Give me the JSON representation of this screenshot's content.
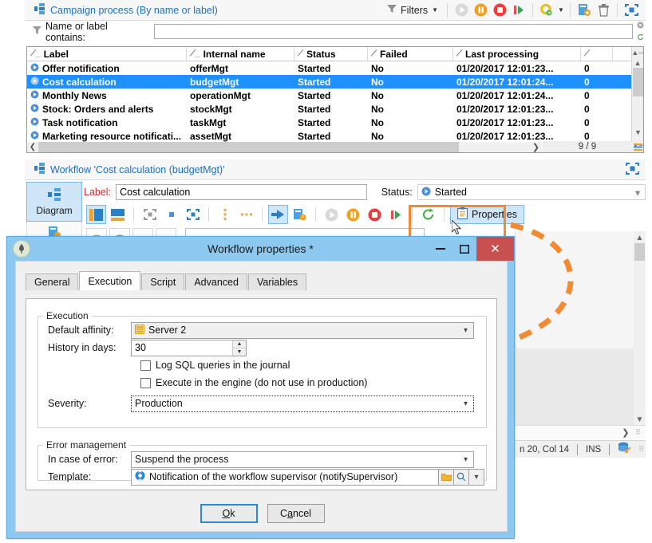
{
  "top_toolbar": {
    "title": "Campaign process (By name or label)",
    "filters_label": "Filters",
    "icons": [
      "funnel-icon",
      "play-disabled-icon",
      "pause-icon",
      "stop-icon",
      "start-icon",
      "settings-gear-icon",
      "duplicate-icon",
      "delete-icon",
      "fullscreen-icon"
    ]
  },
  "filter_row": {
    "label": "Name or label contains:",
    "value": "",
    "placeholder": ""
  },
  "grid": {
    "columns": [
      "Label",
      "Internal name",
      "Status",
      "Failed",
      "Last processing"
    ],
    "rows": [
      {
        "label": "Offer notification",
        "internal": "offerMgt",
        "status": "Started",
        "failed": "No",
        "last": "01/20/2017 12:01:23...",
        "extra": "0",
        "selected": false
      },
      {
        "label": "Cost calculation",
        "internal": "budgetMgt",
        "status": "Started",
        "failed": "No",
        "last": "01/20/2017 12:01:24...",
        "extra": "0",
        "selected": true
      },
      {
        "label": "Monthly News",
        "internal": "operationMgt",
        "status": "Started",
        "failed": "No",
        "last": "01/20/2017 12:01:24...",
        "extra": "0",
        "selected": false
      },
      {
        "label": "Stock: Orders and alerts",
        "internal": "stockMgt",
        "status": "Started",
        "failed": "No",
        "last": "01/20/2017 12:01:23...",
        "extra": "0",
        "selected": false
      },
      {
        "label": "Task notification",
        "internal": "taskMgt",
        "status": "Started",
        "failed": "No",
        "last": "01/20/2017 12:01:23...",
        "extra": "0",
        "selected": false
      },
      {
        "label": "Marketing resource notificati...",
        "internal": "assetMgt",
        "status": "Started",
        "failed": "No",
        "last": "01/20/2017 12:01:23...",
        "extra": "0",
        "selected": false
      }
    ],
    "count": "9 / 9"
  },
  "workflow": {
    "panel_title": "Workflow 'Cost calculation (budgetMgt)'",
    "left_tab": "Diagram",
    "label_caption": "Label:",
    "label_value": "Cost calculation",
    "status_caption": "Status:",
    "status_value": "Started",
    "properties_button": "Properties"
  },
  "status_strip": {
    "position": "n 20, Col 14",
    "mode": "INS",
    "db_icon": "database-key-icon"
  },
  "dialog": {
    "title": "Workflow properties *",
    "tabs": [
      {
        "label": "General",
        "active": false
      },
      {
        "label": "Execution",
        "active": true
      },
      {
        "label": "Script",
        "active": false
      },
      {
        "label": "Advanced",
        "active": false
      },
      {
        "label": "Variables",
        "active": false
      }
    ],
    "execution_group": {
      "legend": "Execution",
      "default_affinity_label": "Default affinity:",
      "default_affinity_value": "Server 2",
      "history_label": "History in days:",
      "history_value": "30",
      "log_sql_label": "Log SQL queries in the journal",
      "log_sql_checked": false,
      "execute_engine_label": "Execute in the engine (do not use in production)",
      "execute_engine_checked": false,
      "severity_label": "Severity:",
      "severity_value": "Production"
    },
    "error_group": {
      "legend": "Error management",
      "in_case_label": "In case of error:",
      "in_case_value": "Suspend the process",
      "template_label": "Template:",
      "template_value": "Notification of the workflow supervisor (notifySupervisor)"
    },
    "buttons": {
      "ok": "Ok",
      "cancel": "Cancel"
    },
    "window_controls": {
      "minimize": "–",
      "maximize": "□",
      "close": "✕"
    }
  },
  "colors": {
    "accent_blue": "#1e90ff",
    "annotation_orange": "#F08A33",
    "dialog_frame": "#8CC8F0",
    "close_red": "#C75050",
    "link_blue": "#1f6fbf"
  }
}
